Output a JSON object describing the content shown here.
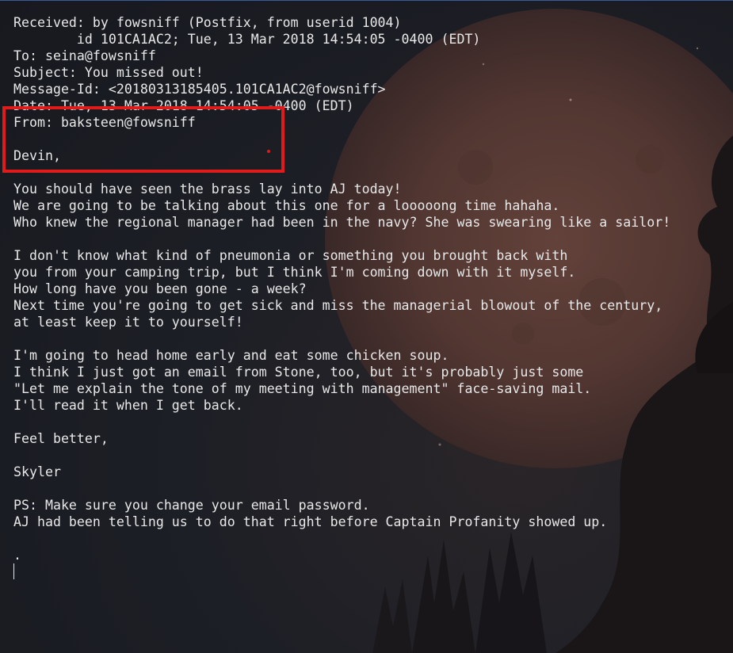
{
  "email": {
    "lines": [
      "Received: by fowsniff (Postfix, from userid 1004)",
      "        id 101CA1AC2; Tue, 13 Mar 2018 14:54:05 -0400 (EDT)",
      "To: seina@fowsniff",
      "Subject: You missed out!",
      "Message-Id: <20180313185405.101CA1AC2@fowsniff>",
      "Date: Tue, 13 Mar 2018 14:54:05 -0400 (EDT)",
      "From: baksteen@fowsniff",
      "",
      "Devin,",
      "",
      "You should have seen the brass lay into AJ today!",
      "We are going to be talking about this one for a looooong time hahaha.",
      "Who knew the regional manager had been in the navy? She was swearing like a sailor!",
      "",
      "I don't know what kind of pneumonia or something you brought back with",
      "you from your camping trip, but I think I'm coming down with it myself.",
      "How long have you been gone - a week?",
      "Next time you're going to get sick and miss the managerial blowout of the century,",
      "at least keep it to yourself!",
      "",
      "I'm going to head home early and eat some chicken soup.",
      "I think I just got an email from Stone, too, but it's probably just some",
      "\"Let me explain the tone of my meeting with management\" face-saving mail.",
      "I'll read it when I get back.",
      "",
      "Feel better,",
      "",
      "Skyler",
      "",
      "PS: Make sure you change your email password.",
      "AJ had been telling us to do that right before Captain Profanity showed up.",
      "",
      "."
    ]
  },
  "colors": {
    "text": "#e8e8e8",
    "highlight": "#e01b1b",
    "background": "#1b1d24",
    "moon": "#5a3a33"
  }
}
